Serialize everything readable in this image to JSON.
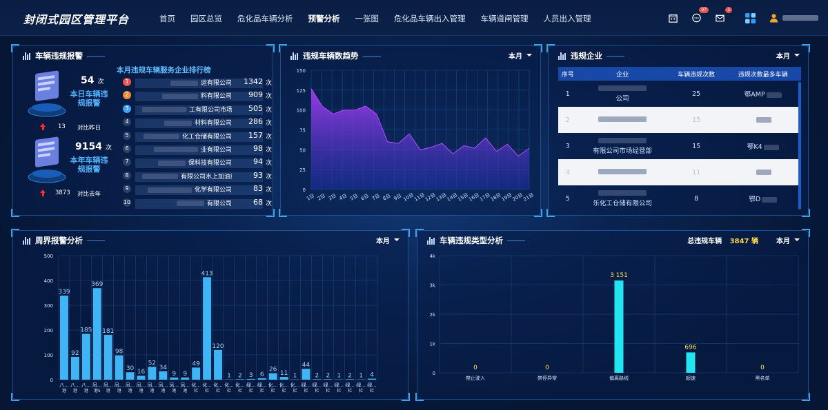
{
  "header": {
    "title": "封闭式园区管理平台",
    "nav": [
      "首页",
      "园区总览",
      "危化品车辆分析",
      "预警分析",
      "一张图",
      "危化品车辆出入管理",
      "车辆道闸管理",
      "人员出入管理"
    ],
    "active_index": 3,
    "badges": {
      "message": "97",
      "mail": "3"
    }
  },
  "panel_violation_alarm": {
    "title": "车辆违规报警",
    "today": {
      "count": "54",
      "unit": "次",
      "label": "本日车辆违规报警",
      "compare_value": "13",
      "compare_label": "对比昨日"
    },
    "year": {
      "count": "9154",
      "unit": "次",
      "label": "本年车辆违规报警",
      "compare_value": "3873",
      "compare_label": "对比去年"
    },
    "rank_title": "本月违规车辆服务企业排行榜",
    "rank": [
      {
        "no": "1",
        "name": "运有限公司",
        "count": "1342",
        "unit": "次",
        "color": "#e85454"
      },
      {
        "no": "2",
        "name": "料有限公司",
        "count": "909",
        "unit": "次",
        "color": "#f08a3a"
      },
      {
        "no": "3",
        "name": "工有限公司市场经营部",
        "count": "505",
        "unit": "次",
        "color": "#3aa0f0"
      },
      {
        "no": "4",
        "name": "材料有限公司",
        "count": "286",
        "unit": "次",
        "color": "#2a3f66"
      },
      {
        "no": "5",
        "name": "化工仓储有限公司",
        "count": "157",
        "unit": "次",
        "color": "#2a3f66"
      },
      {
        "no": "6",
        "name": "业有限公司",
        "count": "98",
        "unit": "次",
        "color": "#2a3f66"
      },
      {
        "no": "7",
        "name": "保科技有限公司",
        "count": "94",
        "unit": "次",
        "color": "#2a3f66"
      },
      {
        "no": "8",
        "name": "有限公司水上加油站",
        "count": "93",
        "unit": "次",
        "color": "#2a3f66"
      },
      {
        "no": "9",
        "name": "化学有限公司",
        "count": "83",
        "unit": "次",
        "color": "#2a3f66"
      },
      {
        "no": "10",
        "name": "有限公司",
        "count": "68",
        "unit": "次",
        "color": "#2a3f66"
      }
    ]
  },
  "panel_trend": {
    "title": "违规车辆数趋势",
    "period": "本月",
    "chart_data": {
      "type": "area",
      "x": [
        "1日",
        "2日",
        "3日",
        "4日",
        "5日",
        "6日",
        "7日",
        "8日",
        "9日",
        "10日",
        "11日",
        "12日",
        "13日",
        "14日",
        "15日",
        "16日",
        "17日",
        "18日",
        "19日",
        "20日",
        "21日"
      ],
      "values": [
        127,
        105,
        95,
        100,
        100,
        105,
        95,
        60,
        58,
        70,
        50,
        53,
        58,
        45,
        55,
        52,
        65,
        48,
        57,
        42,
        52
      ],
      "ylim": [
        0,
        150
      ],
      "yticks": [
        0,
        25,
        50,
        75,
        100,
        125,
        150
      ]
    }
  },
  "panel_enterprise": {
    "title": "违规企业",
    "period": "本月",
    "columns": [
      "序号",
      "企业",
      "车辆违规次数",
      "违规次数最多车辆"
    ],
    "rows": [
      {
        "no": "1",
        "company": "公司",
        "count": "25",
        "plate": "鄂AMP"
      },
      {
        "no": "2",
        "company": "",
        "count": "15",
        "plate": ""
      },
      {
        "no": "3",
        "company": "有限公司市场经营部",
        "count": "15",
        "plate": "鄂K4"
      },
      {
        "no": "4",
        "company": "",
        "count": "11",
        "plate": ""
      },
      {
        "no": "5",
        "company": "乐化工仓储有限公司",
        "count": "8",
        "plate": "鄂D"
      }
    ]
  },
  "panel_perimeter": {
    "title": "周界报警分析",
    "period": "本月",
    "chart_data": {
      "type": "bar",
      "categories": [
        "八...港...",
        "八...港...",
        "八...港...",
        "凤...港5",
        "凤...港...",
        "凤...港...",
        "凤...港...",
        "凤...港...",
        "凤...港...",
        "凤...港...",
        "凤...港...",
        "凤...港...",
        "化...栏...",
        "化...栏...",
        "化...栏...",
        "化...栏...",
        "化...栏...",
        "绿...栏...",
        "绿...栏...",
        "化...栏...",
        "化...栏...",
        "化...栏...",
        "绿...栏...",
        "绿...栏...",
        "绿...栏...",
        "绿...栏...",
        "绿...栏...",
        "绿...栏..."
      ],
      "values": [
        339,
        92,
        185,
        369,
        181,
        98,
        30,
        16,
        52,
        34,
        9,
        9,
        49,
        413,
        120,
        1,
        2,
        3,
        6,
        26,
        11,
        1,
        44,
        2,
        2,
        1,
        2,
        1,
        4
      ],
      "ylim": [
        0,
        500
      ],
      "yticks": [
        0,
        100,
        200,
        300,
        400,
        500
      ],
      "label_color": "#9fd2ff"
    }
  },
  "panel_type": {
    "title": "车辆违规类型分析",
    "total_label": "总违规车辆",
    "total_value": "3847 辆",
    "period": "本月",
    "chart_data": {
      "type": "bar",
      "categories": [
        "禁止驶入",
        "禁停异常",
        "偏离路线",
        "超速",
        "黑名单"
      ],
      "values": [
        0,
        0,
        3151,
        696,
        0
      ],
      "value_labels": [
        "0",
        "0",
        "3 151",
        "696",
        "0"
      ],
      "ylim": [
        0,
        4000
      ],
      "ytick_labels": [
        "0",
        "1k",
        "2k",
        "3k",
        "4k"
      ]
    }
  }
}
